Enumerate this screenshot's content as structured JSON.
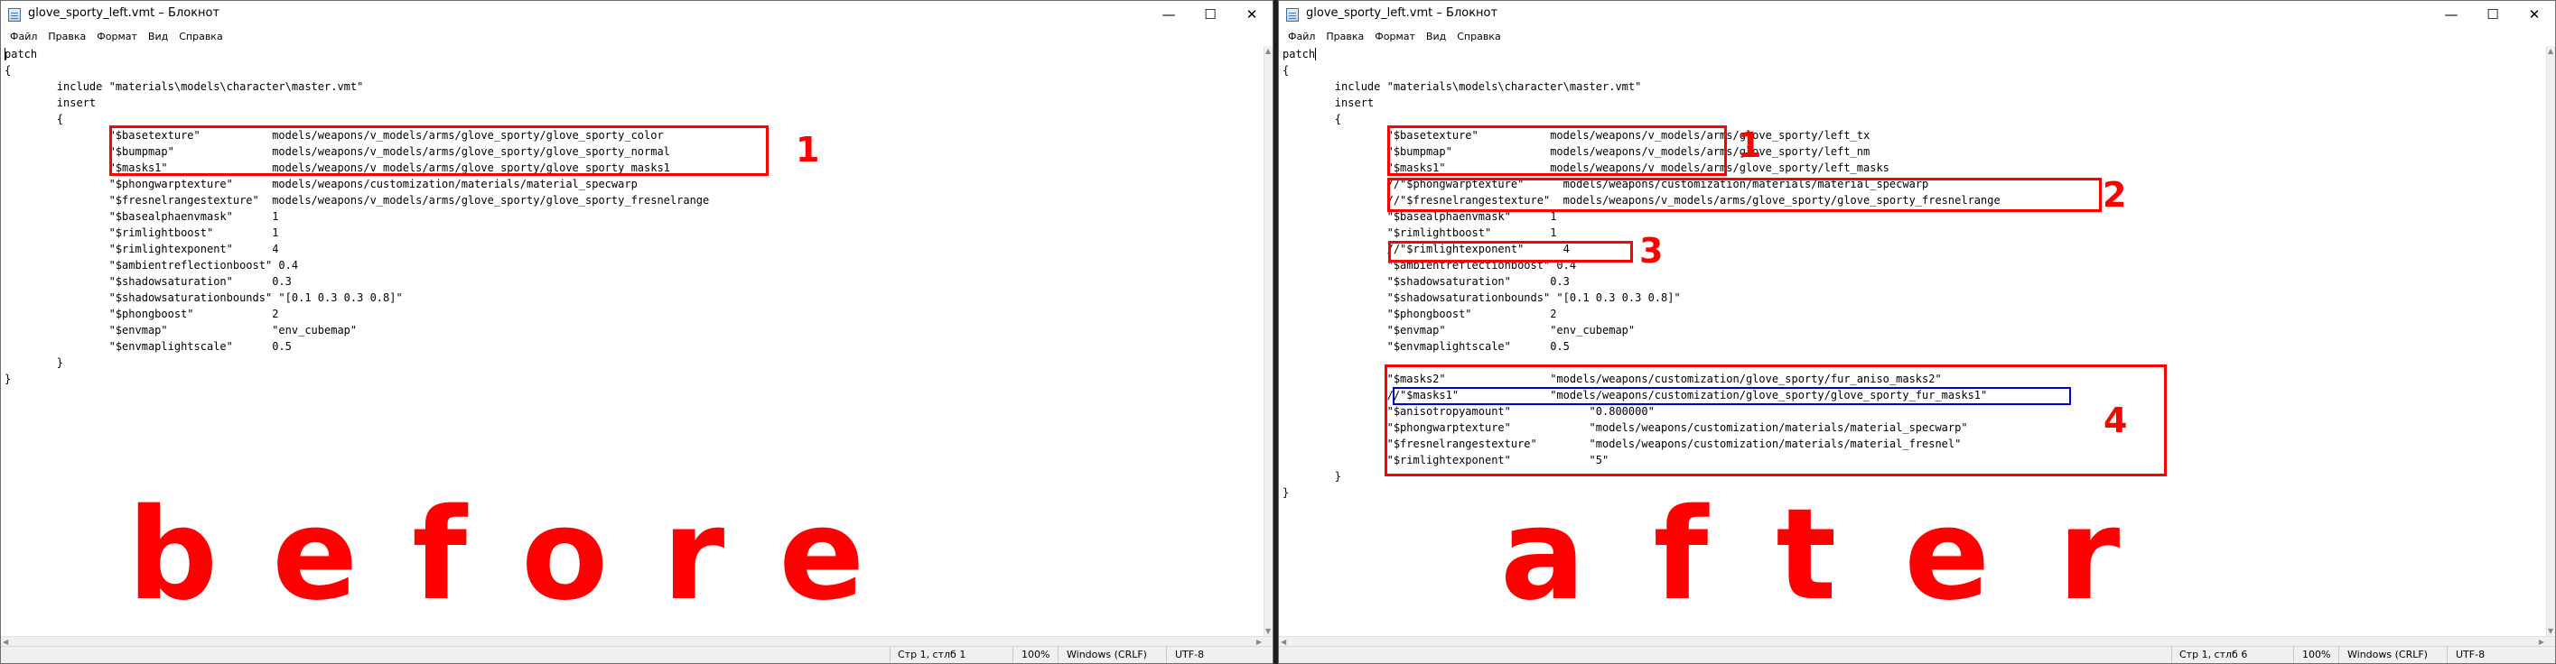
{
  "windows": {
    "left": {
      "title": "glove_sporty_left.vmt – Блокнот",
      "menu": [
        "Файл",
        "Правка",
        "Формат",
        "Вид",
        "Справка"
      ],
      "lines": [
        "patch",
        "{",
        "        include \"materials\\models\\character\\master.vmt\"",
        "        insert",
        "        {",
        "                \"$basetexture\"           models/weapons/v_models/arms/glove_sporty/glove_sporty_color",
        "                \"$bumpmap\"               models/weapons/v_models/arms/glove_sporty/glove_sporty_normal",
        "                \"$masks1\"                models/weapons/v_models/arms/glove_sporty/glove_sporty_masks1",
        "                \"$phongwarptexture\"      models/weapons/customization/materials/material_specwarp",
        "                \"$fresnelrangestexture\"  models/weapons/v_models/arms/glove_sporty/glove_sporty_fresnelrange",
        "                \"$basealphaenvmask\"      1",
        "                \"$rimlightboost\"         1",
        "                \"$rimlightexponent\"      4",
        "                \"$ambientreflectionboost\" 0.4",
        "                \"$shadowsaturation\"      0.3",
        "                \"$shadowsaturationbounds\" \"[0.1 0.3 0.3 0.8]\"",
        "                \"$phongboost\"            2",
        "                \"$envmap\"                \"env_cubemap\"",
        "                \"$envmaplightscale\"      0.5",
        "        }",
        "}"
      ],
      "status": {
        "position": "Стр 1, стлб 1",
        "zoom": "100%",
        "eol": "Windows (CRLF)",
        "encoding": "UTF-8"
      },
      "annotations": {
        "label_1": "1"
      },
      "caption": "before"
    },
    "right": {
      "title": "glove_sporty_left.vmt – Блокнот",
      "menu": [
        "Файл",
        "Правка",
        "Формат",
        "Вид",
        "Справка"
      ],
      "lines": [
        "patch",
        "{",
        "        include \"materials\\models\\character\\master.vmt\"",
        "        insert",
        "        {",
        "                \"$basetexture\"           models/weapons/v_models/arms/glove_sporty/left_tx",
        "                \"$bumpmap\"               models/weapons/v_models/arms/glove_sporty/left_nm",
        "                \"$masks1\"                models/weapons/v_models/arms/glove_sporty/left_masks",
        "                //\"$phongwarptexture\"      models/weapons/customization/materials/material_specwarp",
        "                //\"$fresnelrangestexture\"  models/weapons/v_models/arms/glove_sporty/glove_sporty_fresnelrange",
        "                \"$basealphaenvmask\"      1",
        "                \"$rimlightboost\"         1",
        "                //\"$rimlightexponent\"      4",
        "                \"$ambientreflectionboost\" 0.4",
        "                \"$shadowsaturation\"      0.3",
        "                \"$shadowsaturationbounds\" \"[0.1 0.3 0.3 0.8]\"",
        "                \"$phongboost\"            2",
        "                \"$envmap\"                \"env_cubemap\"",
        "                \"$envmaplightscale\"      0.5",
        "",
        "                \"$masks2\"                \"models/weapons/customization/glove_sporty/fur_aniso_masks2\"",
        "                //\"$masks1\"              \"models/weapons/customization/glove_sporty/glove_sporty_fur_masks1\"",
        "                \"$anisotropyamount\"            \"0.800000\"",
        "                \"$phongwarptexture\"            \"models/weapons/customization/materials/material_specwarp\"",
        "                \"$fresnelrangestexture\"        \"models/weapons/customization/materials/material_fresnel\"",
        "                \"$rimlightexponent\"            \"5\"",
        "        }",
        "}"
      ],
      "status": {
        "position": "Стр 1, стлб 6",
        "zoom": "100%",
        "eol": "Windows (CRLF)",
        "encoding": "UTF-8"
      },
      "annotations": {
        "label_1": "1",
        "label_2": "2",
        "label_3": "3",
        "label_4": "4"
      },
      "caption": "after"
    }
  },
  "colors": {
    "annotation": "#ff0000",
    "highlight_blue": "#0000c8"
  }
}
